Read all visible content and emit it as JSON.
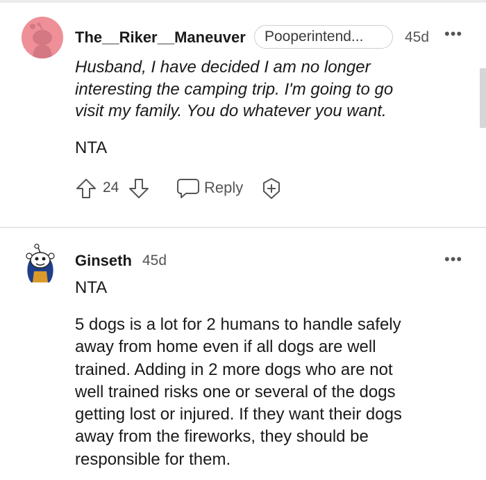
{
  "comments": [
    {
      "username": "The__Riker__Maneuver",
      "flair": "Pooperintend...",
      "age": "45d",
      "more": "•••",
      "quote_lines": [
        "Husband, I have decided I am no longer",
        "interesting the camping trip. I'm going to go",
        "visit my family. You do whatever you want."
      ],
      "verdict": "NTA",
      "score": "24",
      "reply_label": "Reply",
      "avatar_color": "#ef8f97"
    },
    {
      "username": "Ginseth",
      "age": "45d",
      "more": "•••",
      "verdict": "NTA",
      "paragraph_lines": [
        "5 dogs is a lot for 2 humans to handle safely",
        "away from home even if all dogs are well",
        "trained. Adding in 2 more dogs who are not",
        "well trained risks one or several of the dogs",
        "getting lost or injured. If they want their dogs",
        "away from the fireworks, they should be",
        "responsible for them."
      ]
    }
  ],
  "icons": {
    "upvote": "upvote-icon",
    "downvote": "downvote-icon",
    "reply": "reply-icon",
    "award": "award-icon",
    "more": "more-options-icon"
  }
}
